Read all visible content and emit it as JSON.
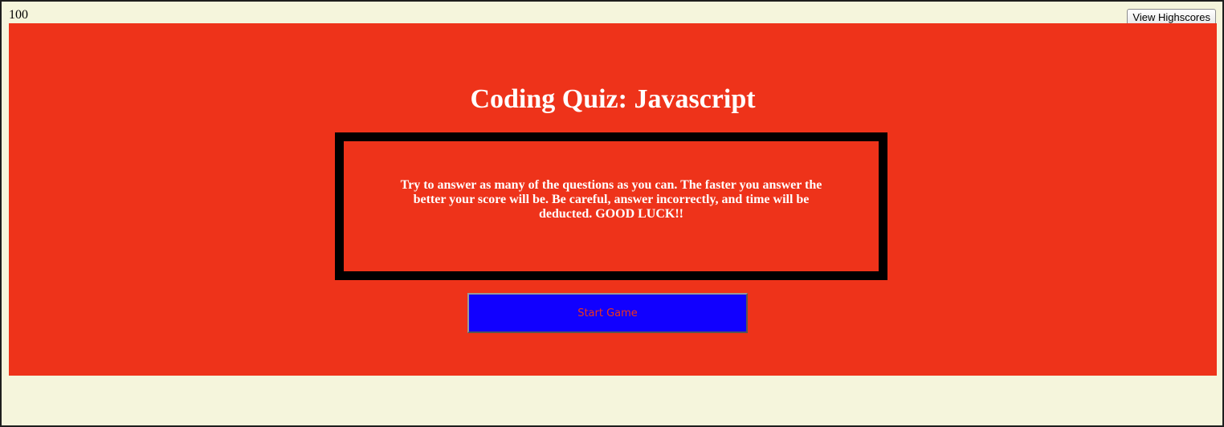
{
  "header": {
    "timer_value": "100",
    "highscores_label": "View Highscores"
  },
  "quiz": {
    "title": "Coding Quiz: Javascript",
    "instructions": "Try to answer as many of the questions as you can. The faster you answer the better your score will be. Be careful, answer incorrectly, and time will be deducted. GOOD LUCK!!",
    "start_label": "Start Game"
  },
  "colors": {
    "page_background": "#f5f5dc",
    "panel_background": "#ee331a",
    "start_button_background": "#1100ff",
    "start_button_text": "#ee331a",
    "box_border": "#000000"
  }
}
